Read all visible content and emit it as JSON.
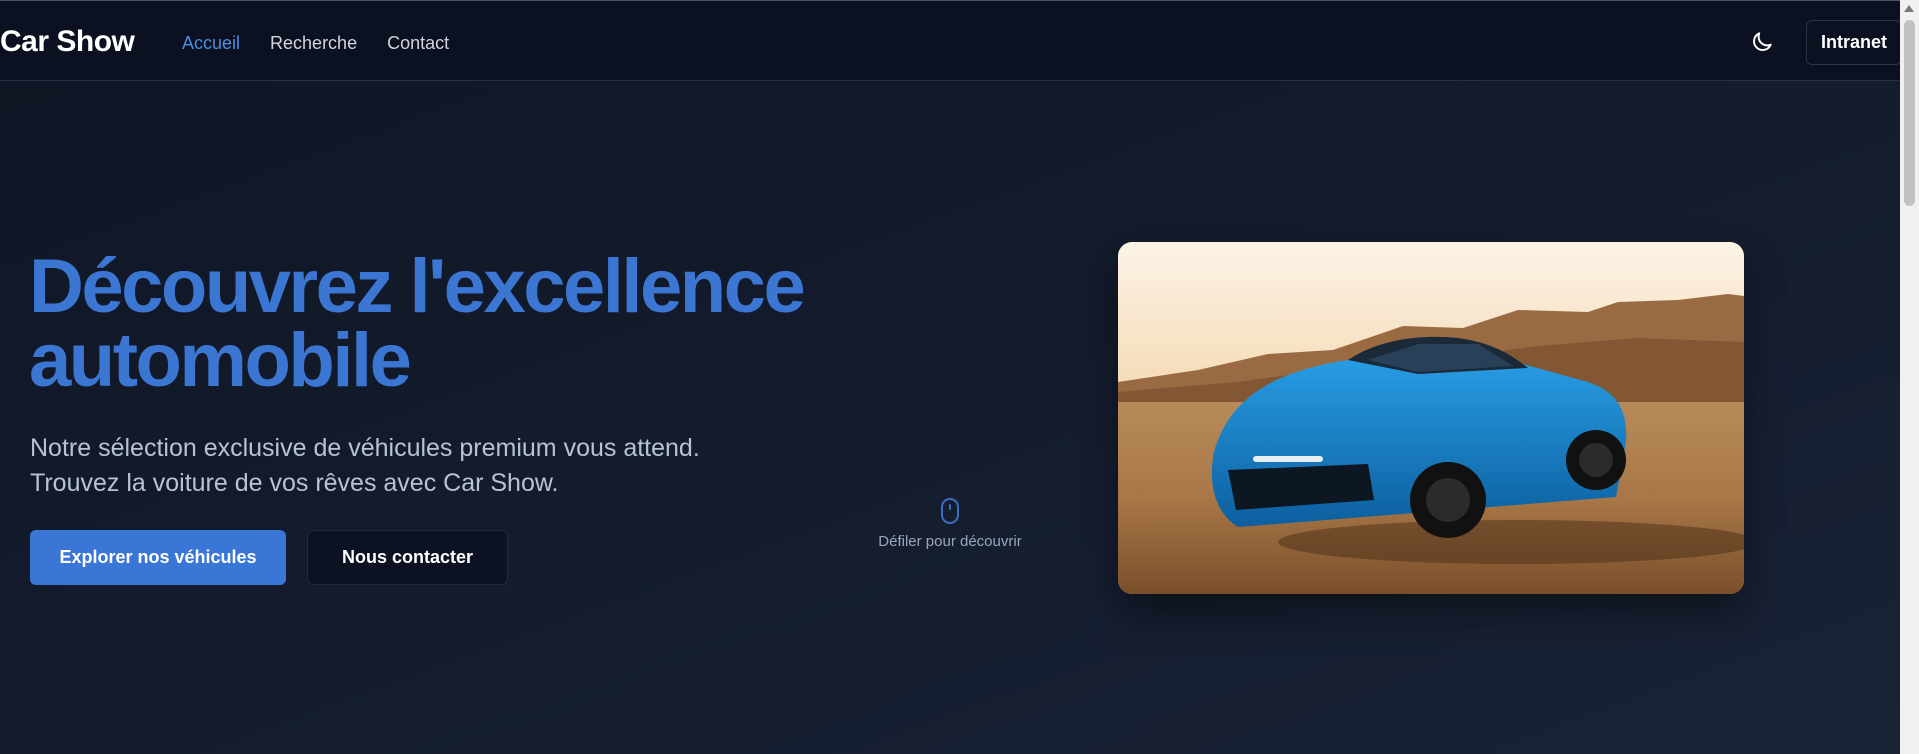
{
  "header": {
    "brand": "Car Show",
    "nav": [
      {
        "label": "Accueil",
        "active": true
      },
      {
        "label": "Recherche",
        "active": false
      },
      {
        "label": "Contact",
        "active": false
      }
    ],
    "theme_icon": "moon-icon",
    "intranet_label": "Intranet"
  },
  "hero": {
    "title_line1": "Découvrez l'excellence",
    "title_line2": "automobile",
    "subtitle_line1": "Notre sélection exclusive de véhicules premium vous attend.",
    "subtitle_line2": "Trouvez la voiture de vos rêves avec Car Show.",
    "primary_button": "Explorer nos véhicules",
    "secondary_button": "Nous contacter",
    "scroll_icon": "mouse-icon",
    "scroll_hint": "Défiler pour découvrir",
    "image_subject": "blue sports car in desert"
  },
  "colors": {
    "accent": "#3a76d6",
    "title": "#3b76d3",
    "nav_active": "#4d8ce3",
    "background": "#131b2c",
    "header": "#0b1120"
  }
}
